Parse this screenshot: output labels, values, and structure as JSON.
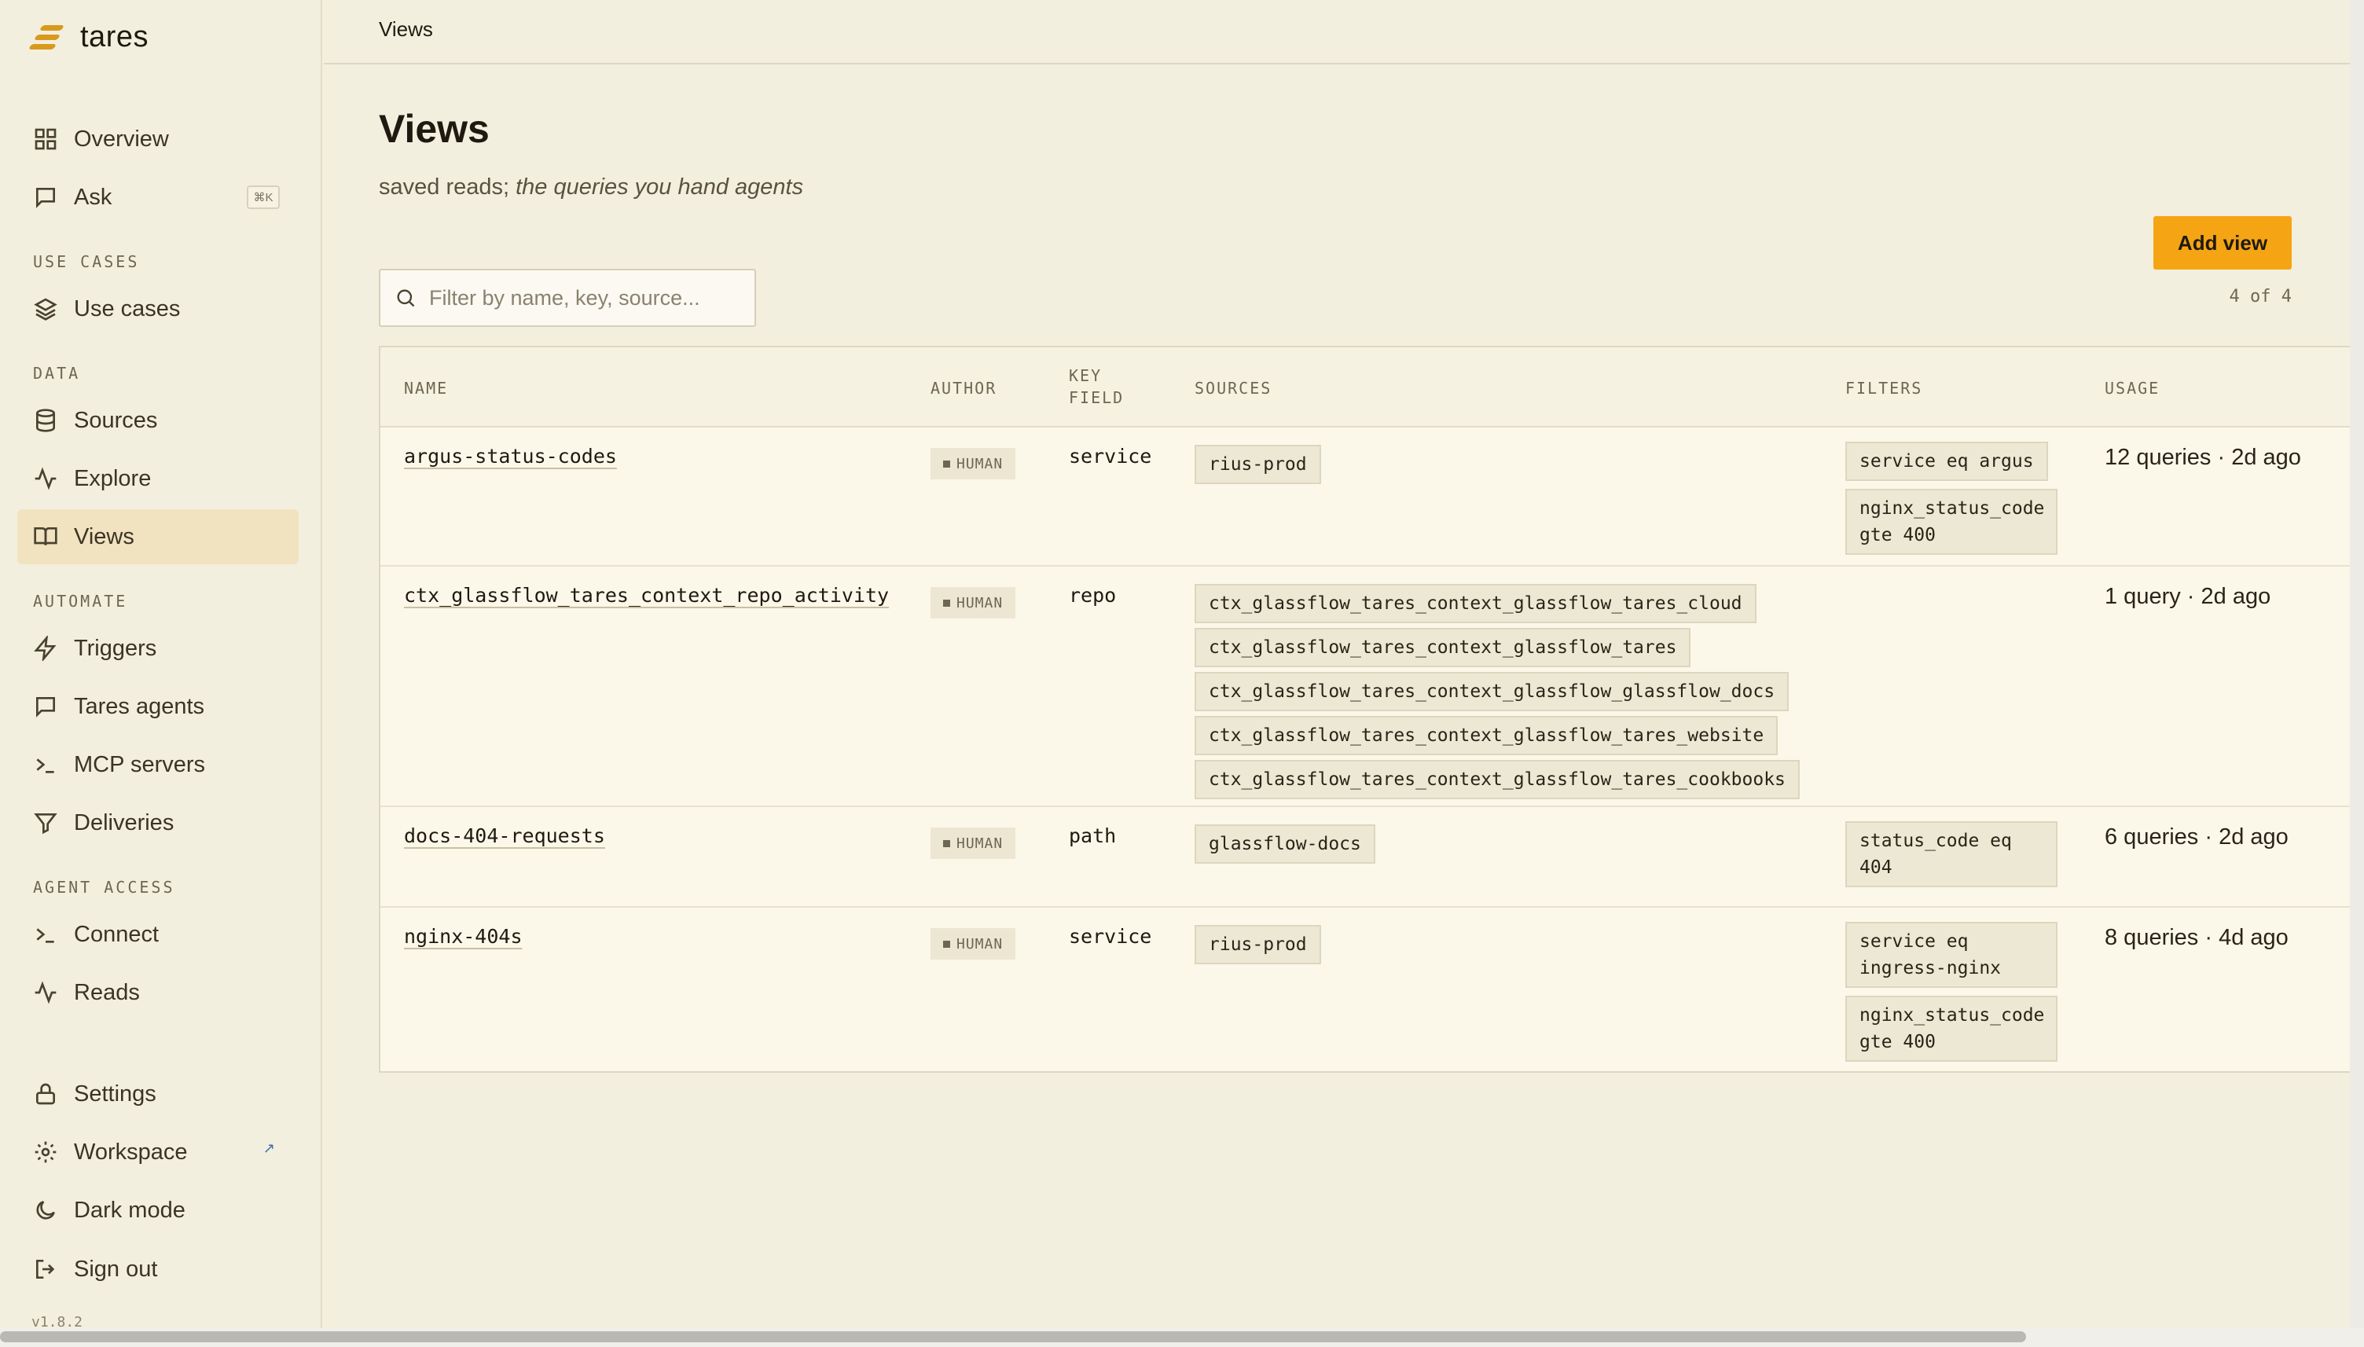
{
  "app": {
    "name": "tares",
    "version": "v1.8.2"
  },
  "sidebar": {
    "overview": "Overview",
    "ask": "Ask",
    "ask_shortcut": "⌘K",
    "use_cases_section": "USE CASES",
    "use_cases": "Use cases",
    "data_section": "DATA",
    "sources": "Sources",
    "explore": "Explore",
    "views": "Views",
    "automate_section": "AUTOMATE",
    "triggers": "Triggers",
    "tares_agents": "Tares agents",
    "mcp_servers": "MCP servers",
    "deliveries": "Deliveries",
    "agent_access_section": "AGENT ACCESS",
    "connect": "Connect",
    "reads": "Reads",
    "settings": "Settings",
    "workspace": "Workspace",
    "dark_mode": "Dark mode",
    "sign_out": "Sign out"
  },
  "topbar": {
    "title": "Views"
  },
  "page": {
    "title": "Views",
    "subtitle_plain": "saved reads; ",
    "subtitle_italic": "the queries you hand agents",
    "add_button": "Add view",
    "count": "4 of 4",
    "search_placeholder": "Filter by name, key, source..."
  },
  "table": {
    "headers": {
      "name": "NAME",
      "author": "AUTHOR",
      "key_field_1": "KEY",
      "key_field_2": "FIELD",
      "sources": "SOURCES",
      "filters": "FILTERS",
      "usage": "USAGE"
    },
    "rows": [
      {
        "name": "argus-status-codes",
        "author": "HUMAN",
        "key": "service",
        "sources": [
          "rius-prod"
        ],
        "filters": [
          "service eq argus",
          "nginx_status_code gte 400"
        ],
        "usage": "12 queries · 2d ago"
      },
      {
        "name": "ctx_glassflow_tares_context_repo_activity",
        "author": "HUMAN",
        "key": "repo",
        "sources": [
          "ctx_glassflow_tares_context_glassflow_tares_cloud",
          "ctx_glassflow_tares_context_glassflow_tares",
          "ctx_glassflow_tares_context_glassflow_glassflow_docs",
          "ctx_glassflow_tares_context_glassflow_tares_website",
          "ctx_glassflow_tares_context_glassflow_tares_cookbooks"
        ],
        "filters": [],
        "usage": "1 query · 2d ago"
      },
      {
        "name": "docs-404-requests",
        "author": "HUMAN",
        "key": "path",
        "sources": [
          "glassflow-docs"
        ],
        "filters": [
          "status_code eq 404"
        ],
        "usage": "6 queries · 2d ago"
      },
      {
        "name": "nginx-404s",
        "author": "HUMAN",
        "key": "service",
        "sources": [
          "rius-prod"
        ],
        "filters": [
          "service eq ingress-nginx",
          "nginx_status_code gte 400"
        ],
        "usage": "8 queries · 4d ago"
      }
    ]
  },
  "colors": {
    "accent": "#f5a514",
    "active_nav": "#f1e3c0",
    "background": "#f3efdf",
    "logo": "#d89a1c"
  }
}
